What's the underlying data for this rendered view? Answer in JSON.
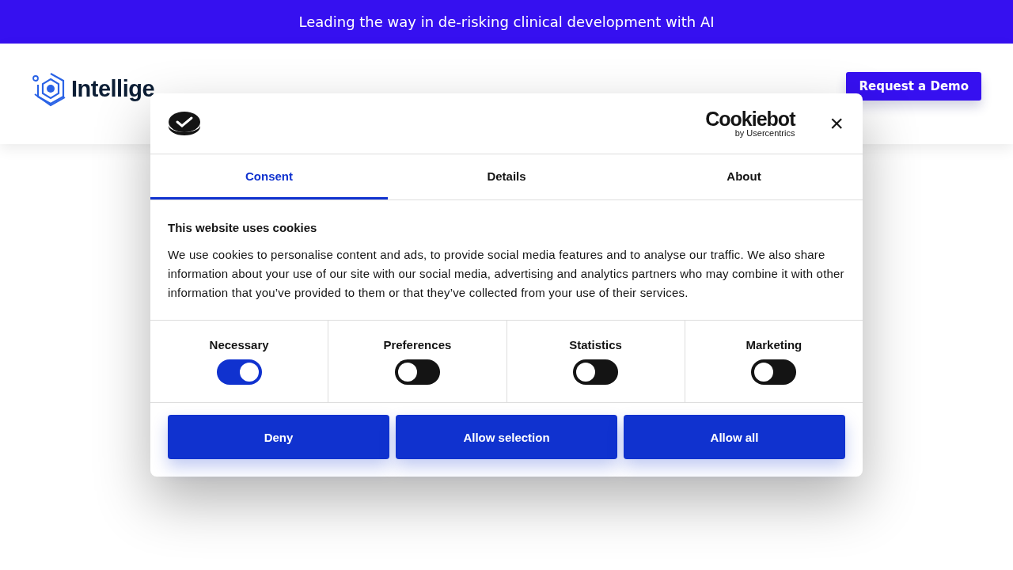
{
  "banner": {
    "text": "Leading the way in de-risking clinical development with AI"
  },
  "header": {
    "logo_text": "Intellige",
    "cta": "Request a Demo"
  },
  "dialog": {
    "brand": "Cookiebot",
    "brand_sub": "by Usercentrics",
    "close": "×",
    "tabs": [
      {
        "label": "Consent",
        "selected": true
      },
      {
        "label": "Details",
        "selected": false
      },
      {
        "label": "About",
        "selected": false
      }
    ],
    "heading": "This website uses cookies",
    "body": "We use cookies to personalise content and ads, to provide social media features and to analyse our traffic. We also share information about your use of our site with our social media, advertising and analytics partners who may combine it with other information that you’ve provided to them or that they’ve collected from your use of their services.",
    "categories": [
      {
        "label": "Necessary",
        "on": true
      },
      {
        "label": "Preferences",
        "on": false
      },
      {
        "label": "Statistics",
        "on": false
      },
      {
        "label": "Marketing",
        "on": false
      }
    ],
    "buttons": [
      "Deny",
      "Allow selection",
      "Allow all"
    ]
  }
}
